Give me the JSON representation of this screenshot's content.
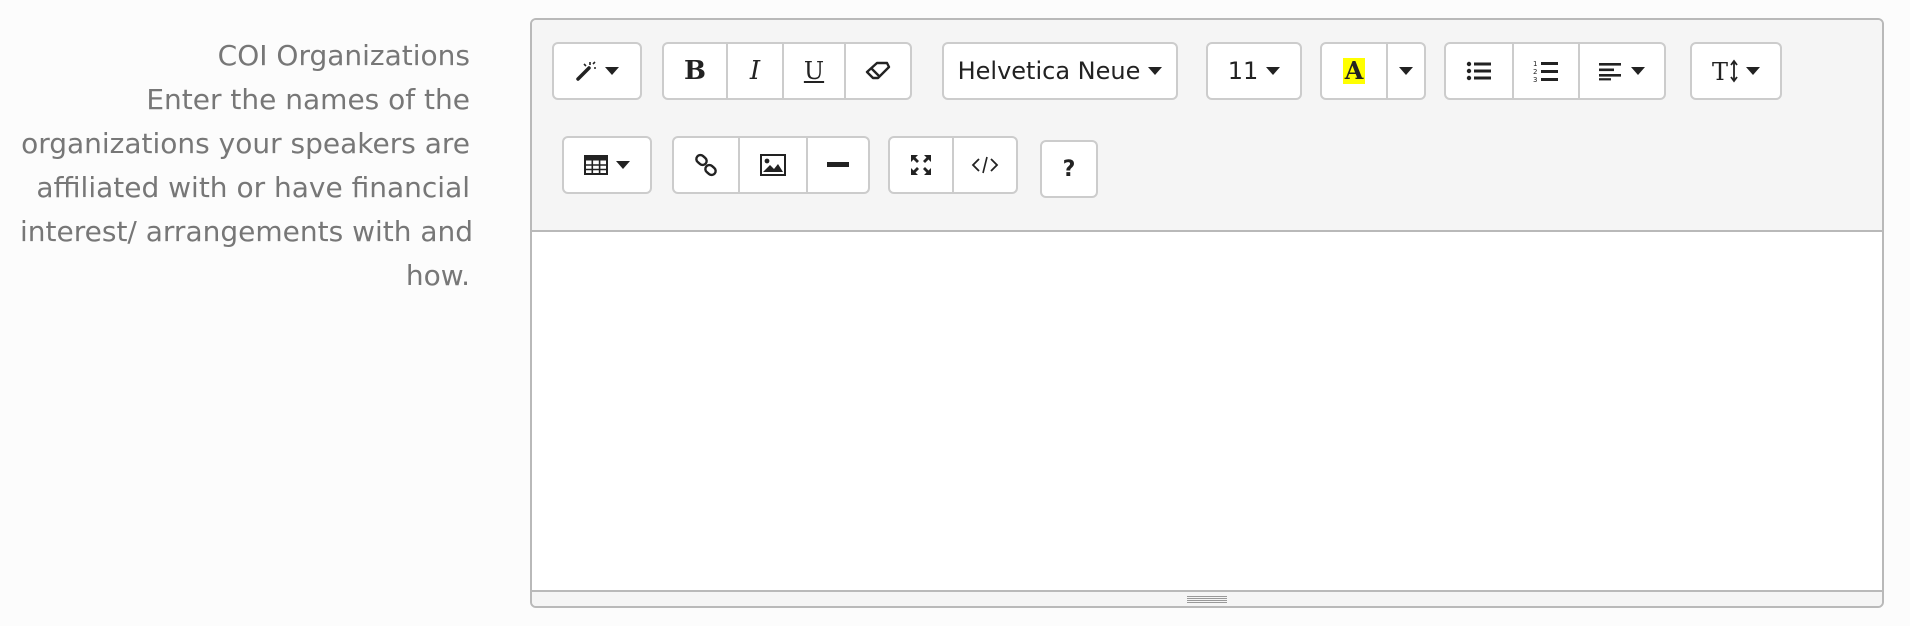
{
  "field": {
    "title": "COI Organizations",
    "help_lines": [
      "Enter the names of the",
      "organizations your speakers are",
      "affiliated with or have financial",
      "interest/ arrangements with and",
      "how."
    ]
  },
  "toolbar": {
    "font_name": "Helvetica Neue",
    "font_size": "11",
    "bold_label": "B",
    "italic_label": "I",
    "underline_label": "U",
    "highlight_label": "A",
    "help_label": "?",
    "highlight_color": "#ffff00",
    "icons": {
      "style": "magic-wand-icon",
      "eraser": "eraser-icon",
      "ul": "unordered-list-icon",
      "ol": "ordered-list-icon",
      "align": "align-left-icon",
      "line_height": "text-height-icon",
      "table": "table-icon",
      "link": "link-icon",
      "picture": "picture-icon",
      "hr": "horizontal-rule-icon",
      "fullscreen": "fullscreen-icon",
      "codeview": "code-icon"
    }
  },
  "editor": {
    "content": ""
  }
}
